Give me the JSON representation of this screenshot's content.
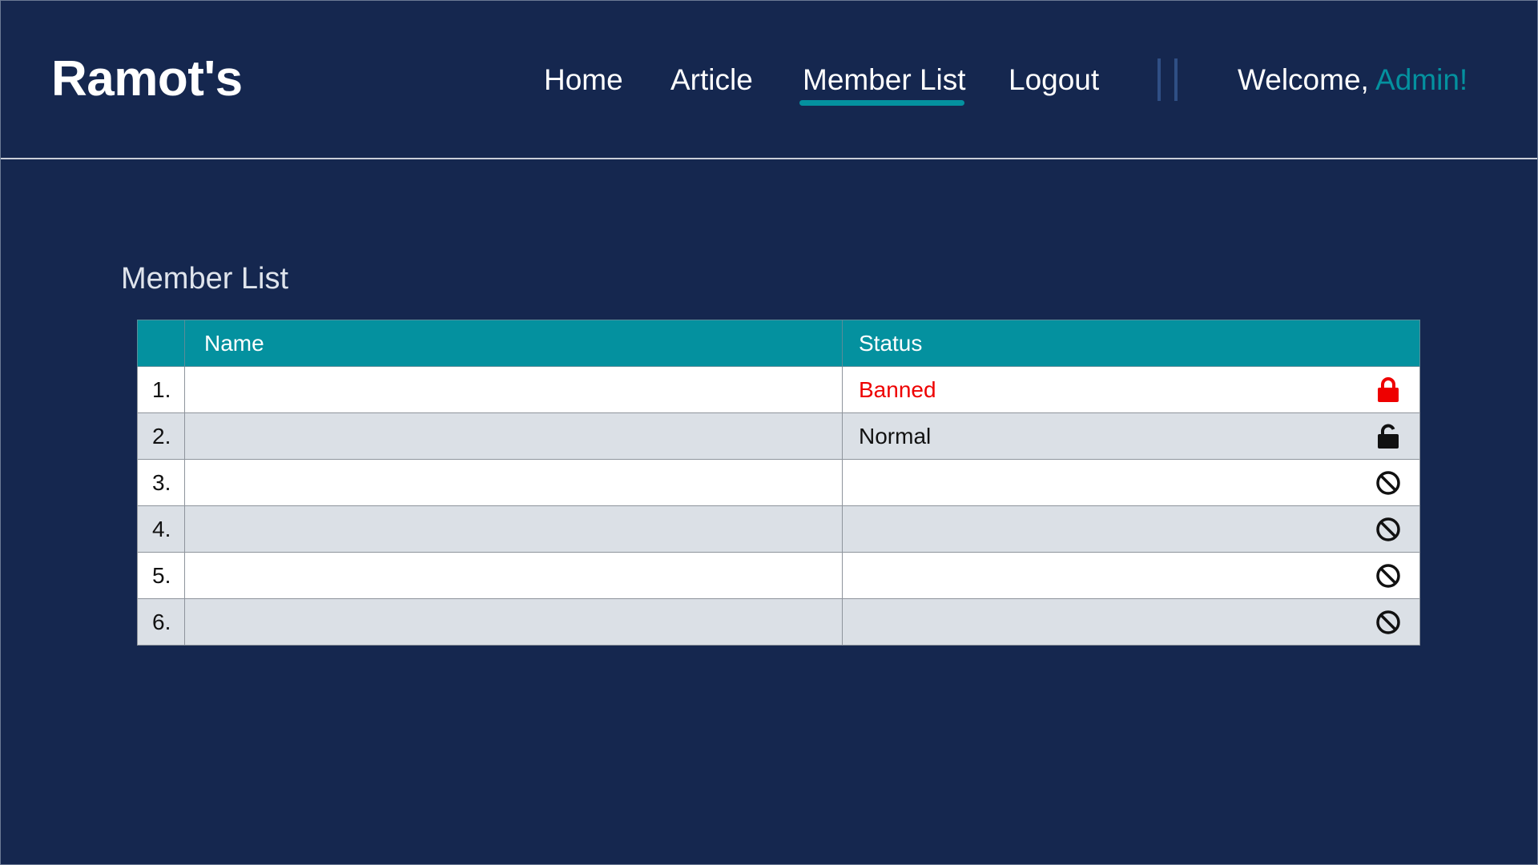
{
  "header": {
    "brand": "Ramot's",
    "nav": [
      {
        "label": "Home"
      },
      {
        "label": "Article"
      },
      {
        "label": "Member List",
        "active": true
      },
      {
        "label": "Logout"
      }
    ],
    "welcome_prefix": "Welcome, ",
    "welcome_user": "Admin!"
  },
  "main": {
    "title": "Member List",
    "table": {
      "columns": [
        "",
        "Name",
        "Status"
      ],
      "rows": [
        {
          "num": "1.",
          "name": "",
          "status": "Banned",
          "icon": "lock-closed-icon"
        },
        {
          "num": "2.",
          "name": "",
          "status": "Normal",
          "icon": "lock-open-icon"
        },
        {
          "num": "3.",
          "name": "",
          "status": "",
          "icon": "ban-icon"
        },
        {
          "num": "4.",
          "name": "",
          "status": "",
          "icon": "ban-icon"
        },
        {
          "num": "5.",
          "name": "",
          "status": "",
          "icon": "ban-icon"
        },
        {
          "num": "6.",
          "name": "",
          "status": "",
          "icon": "ban-icon"
        }
      ]
    }
  },
  "colors": {
    "background": "#15274f",
    "accent": "#04919f",
    "banned": "#ee0000",
    "row_alt": "#dbe0e6"
  }
}
